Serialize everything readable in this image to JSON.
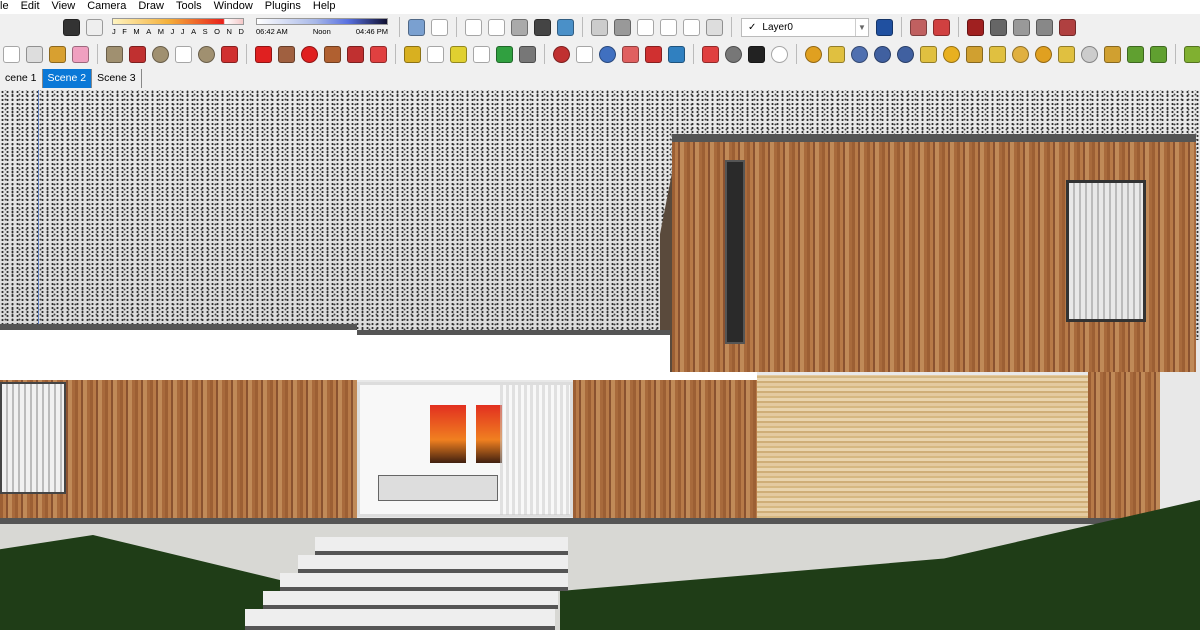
{
  "menu": [
    "le",
    "Edit",
    "View",
    "Camera",
    "Draw",
    "Tools",
    "Window",
    "Plugins",
    "Help"
  ],
  "shadow": {
    "months": [
      "J",
      "F",
      "M",
      "A",
      "M",
      "J",
      "J",
      "A",
      "S",
      "O",
      "N",
      "D"
    ],
    "time_start": "06:42 AM",
    "time_mid": "Noon",
    "time_end": "04:46 PM"
  },
  "layer": {
    "check": "✓",
    "name": "Layer0"
  },
  "scenes": [
    {
      "label": "cene 1"
    },
    {
      "label": "Scene 2",
      "active": true
    },
    {
      "label": "Scene 3"
    }
  ],
  "colors": {
    "accent": "#0a78d7"
  },
  "toolbar_row1": [
    {
      "name": "shadow-settings-icon",
      "c": "#333"
    },
    {
      "name": "shadow-toggle-icon",
      "c": "#eee"
    },
    "months",
    "timeb",
    "sep",
    {
      "name": "iso-view-icon",
      "c": "#7aa0d0"
    },
    {
      "name": "top-view-icon",
      "c": "#fff"
    },
    "sep",
    {
      "name": "xray-icon",
      "c": "#fff"
    },
    {
      "name": "wireframe-icon",
      "c": "#fff"
    },
    {
      "name": "shaded-icon",
      "c": "#aaa"
    },
    {
      "name": "shaded-textures-icon",
      "c": "#444"
    },
    {
      "name": "monochrome-icon",
      "c": "#4a90c8"
    },
    "sep",
    {
      "name": "iso-house-icon",
      "c": "#ccc"
    },
    {
      "name": "front-view-icon",
      "c": "#999"
    },
    {
      "name": "house-front-icon",
      "c": "#fff"
    },
    {
      "name": "house-right-icon",
      "c": "#fff"
    },
    {
      "name": "house-back-icon",
      "c": "#fff"
    },
    {
      "name": "house-left-icon",
      "c": "#ddd"
    },
    "sep",
    "layer",
    {
      "name": "layer-manager-icon",
      "c": "#2050a0"
    },
    "sep",
    {
      "name": "section-plane-icon",
      "c": "#c06060"
    },
    {
      "name": "section-cut-icon",
      "c": "#d04040"
    },
    "sep",
    {
      "name": "sandbox-from-contours-icon",
      "c": "#a02020"
    },
    {
      "name": "sandbox-scratch-icon",
      "c": "#666"
    },
    {
      "name": "smoove-icon",
      "c": "#999"
    },
    {
      "name": "stamp-icon",
      "c": "#888"
    },
    {
      "name": "drape-icon",
      "c": "#b04040"
    }
  ],
  "toolbar_row2": [
    {
      "name": "select-arrow-icon",
      "c": "#fff"
    },
    {
      "name": "make-component-icon",
      "c": "#ddd"
    },
    {
      "name": "paint-bucket-icon",
      "c": "#d8a030"
    },
    {
      "name": "eraser-icon",
      "c": "#f0a0c0"
    },
    "sep",
    {
      "name": "rectangle-icon",
      "c": "#a09070"
    },
    {
      "name": "line-pencil-icon",
      "c": "#c03030"
    },
    {
      "name": "circle-icon",
      "c": "#a09070",
      "r": 1
    },
    {
      "name": "arc-icon",
      "c": "#fff"
    },
    {
      "name": "polygon-icon",
      "c": "#a09070",
      "r": 1
    },
    {
      "name": "freehand-icon",
      "c": "#d03030"
    },
    "sep",
    {
      "name": "move-icon",
      "c": "#e02020"
    },
    {
      "name": "push-pull-icon",
      "c": "#a06040"
    },
    {
      "name": "rotate-icon",
      "c": "#e02020",
      "r": 1
    },
    {
      "name": "follow-me-icon",
      "c": "#b06030"
    },
    {
      "name": "scale-icon",
      "c": "#c03030"
    },
    {
      "name": "offset-icon",
      "c": "#e04040"
    },
    "sep",
    {
      "name": "tape-measure-icon",
      "c": "#d8b020"
    },
    {
      "name": "dimension-icon",
      "c": "#fff"
    },
    {
      "name": "protractor-icon",
      "c": "#e0d030"
    },
    {
      "name": "text-icon",
      "c": "#fff"
    },
    {
      "name": "axes-icon",
      "c": "#30a040"
    },
    {
      "name": "3d-text-icon",
      "c": "#777"
    },
    "sep",
    {
      "name": "orbit-icon",
      "c": "#c03030",
      "r": 1
    },
    {
      "name": "pan-hand-icon",
      "c": "#fff"
    },
    {
      "name": "zoom-icon",
      "c": "#4070c0",
      "r": 1
    },
    {
      "name": "zoom-window-icon",
      "c": "#e06060"
    },
    {
      "name": "zoom-extents-icon",
      "c": "#d03030"
    },
    {
      "name": "previous-view-icon",
      "c": "#3080c0"
    },
    "sep",
    {
      "name": "position-camera-icon",
      "c": "#e04040"
    },
    {
      "name": "look-around-icon",
      "c": "#777",
      "r": 1
    },
    {
      "name": "walk-icon",
      "c": "#222"
    },
    {
      "name": "position-target-icon",
      "c": "#fff",
      "r": 1
    },
    "sep",
    {
      "name": "material-m-icon",
      "c": "#e0a020",
      "r": 1
    },
    {
      "name": "material-tag-icon",
      "c": "#e0c040"
    },
    {
      "name": "render-r-icon",
      "c": "#5070b0",
      "r": 1
    },
    {
      "name": "render-rt-icon",
      "c": "#4060a0",
      "r": 1
    },
    {
      "name": "help-icon",
      "c": "#4060a0",
      "r": 1
    },
    {
      "name": "tag-icon",
      "c": "#e0c040"
    },
    {
      "name": "sphere-light-icon",
      "c": "#e8b020",
      "r": 1
    },
    {
      "name": "spot-light-icon",
      "c": "#d0a030"
    },
    {
      "name": "flag-light-icon",
      "c": "#e0c040"
    },
    {
      "name": "dome-light-icon",
      "c": "#e0b040",
      "r": 1
    },
    {
      "name": "point-light-icon",
      "c": "#e0a020",
      "r": 1
    },
    {
      "name": "ies-light-icon",
      "c": "#e0c040"
    },
    {
      "name": "omni-light-icon",
      "c": "#ccc",
      "r": 1
    },
    {
      "name": "emitter-icon",
      "c": "#d0a030"
    },
    {
      "name": "tree-proxy-icon",
      "c": "#60a030"
    },
    {
      "name": "tree-proxy-2-icon",
      "c": "#60a030"
    },
    "sep",
    {
      "name": "sun-angle-icon",
      "c": "#80b030"
    }
  ]
}
